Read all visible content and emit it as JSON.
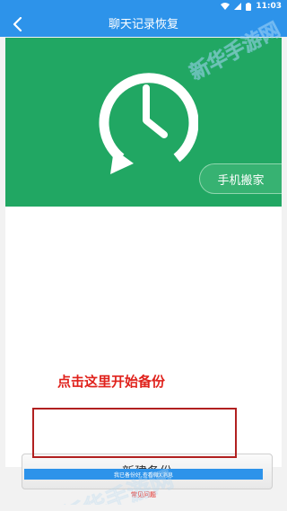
{
  "status_bar": {
    "time": "11:03"
  },
  "header": {
    "title": "聊天记录恢复"
  },
  "hero": {
    "tag_label": "手机搬家"
  },
  "hint": {
    "text": "点击这里开始备份"
  },
  "main": {
    "new_backup_label": "新建备份"
  },
  "footer": {
    "strip_text": "我已备份好,查看微X消息",
    "faq_label": "常见问题"
  },
  "watermark": {
    "text": "新华手游网"
  },
  "colors": {
    "header_blue": "#2d93ea",
    "hero_green": "#21a763",
    "hint_red": "#e0221c"
  }
}
